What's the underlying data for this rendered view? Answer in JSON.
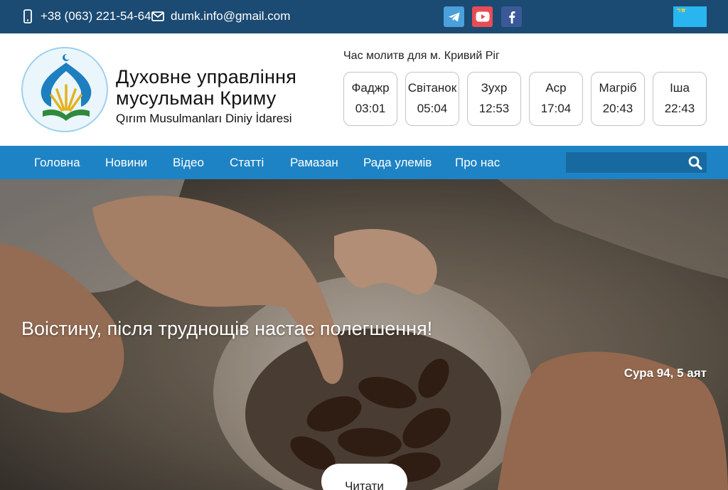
{
  "topbar": {
    "phone": "+38 (063) 221-54-64",
    "email": "dumk.info@gmail.com",
    "social": [
      {
        "name": "telegram-icon",
        "color": "#4b9fdb"
      },
      {
        "name": "youtube-icon",
        "color": "#e74c54"
      },
      {
        "name": "facebook-icon",
        "color": "#3b5998"
      }
    ],
    "flag_color": "#29b6f0",
    "bar_color": "#1b4a72"
  },
  "header": {
    "org_name_line1": "Духовне управління",
    "org_name_line2": "мусульман Криму",
    "org_subtitle": "Qırım Musulmanları Diniy İdaresi"
  },
  "prayer_times": {
    "title": "Час молитв для м. Кривий Ріг",
    "items": [
      {
        "name": "Фаджр",
        "time": "03:01"
      },
      {
        "name": "Світанок",
        "time": "05:04"
      },
      {
        "name": "Зухр",
        "time": "12:53"
      },
      {
        "name": "Аср",
        "time": "17:04"
      },
      {
        "name": "Магріб",
        "time": "20:43"
      },
      {
        "name": "Іша",
        "time": "22:43"
      }
    ]
  },
  "nav": {
    "color": "#1e83c4",
    "items": [
      "Головна",
      "Новини",
      "Відео",
      "Статті",
      "Рамазан",
      "Рада улемів",
      "Про нас"
    ],
    "search_placeholder": ""
  },
  "hero": {
    "headline": "Воістину, після труднощів настає полегшення!",
    "source": "Сура 94, 5 аят",
    "button_label": "Читати"
  }
}
